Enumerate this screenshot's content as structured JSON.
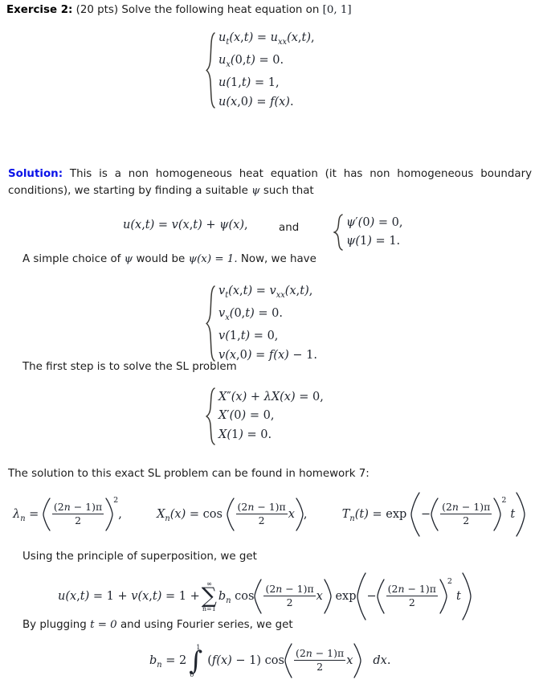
{
  "document": {
    "exercise_label": "Exercise 2:",
    "exercise_prompt": "(20 pts) Solve the following heat equation on",
    "interval": "[0, 1]",
    "solution_label": "Solution:",
    "solution_intro": "This is a non homogeneous heat equation (it has non homogeneous boundary conditions), we starting by finding a suitable",
    "solution_intro_symbol": "ψ",
    "solution_intro_tail": "such that",
    "psi_choice_pre": "A simple choice of",
    "psi_choice_sym": "ψ",
    "psi_choice_mid": "would be",
    "psi_choice_eq": "ψ(x) = 1.",
    "psi_choice_tail": "Now, we have",
    "sl_intro": "The first step is to solve the SL problem",
    "sl_solution_ref": "The solution to this exact SL problem can be found in homework 7:",
    "superposition_intro": "Using the principle of superposition, we get",
    "fourier_intro_pre": "By plugging",
    "fourier_intro_eq": "t = 0",
    "fourier_intro_tail": "and using Fourier series, we get",
    "and_word": "and"
  },
  "equations": {
    "heat_system": {
      "name": "original-heat-equation-system",
      "rows": [
        {
          "lhs_fn": "u",
          "lhs_sub": "t",
          "lhs_args": "(x, t)",
          "eq": "=",
          "rhs_fn": "u",
          "rhs_sub": "xx",
          "rhs_args": "(x, t),",
          "plain": "u_t(x,t) = u_xx(x,t),"
        },
        {
          "plain": "u_x(0,t) = 0."
        },
        {
          "plain": "u(1,t) = 1,"
        },
        {
          "plain": "u(x,0) = f(x)."
        }
      ]
    },
    "substitution": {
      "name": "substitution-equation",
      "text": "u(x,t) = v(x,t) + ψ(x),"
    },
    "psi_conditions": {
      "name": "psi-boundary-conditions",
      "rows": [
        "ψ'(0) = 0,",
        "ψ(1) = 1."
      ]
    },
    "v_system": {
      "name": "transformed-v-system",
      "rows": [
        "v_t(x,t) = v_xx(x,t),",
        "v_x(0,t) = 0.",
        "v(1,t) = 0,",
        "v(x,0) = f(x) − 1."
      ]
    },
    "sl_problem": {
      "name": "sturm-liouville-problem",
      "rows": [
        "X″(x) + λX(x) = 0,",
        "X′(0) = 0,",
        "X(1) = 0."
      ]
    },
    "eigen_line": {
      "name": "eigenvalue-eigenfunction-line",
      "lambda_lhs": "λ",
      "lambda_sub": "n",
      "numerator": "(2n − 1)π",
      "denominator": "2",
      "exponent": "2",
      "lambda_tail": ",",
      "X_lhs": "X",
      "X_sub": "n",
      "X_args": "(x)",
      "X_op": "cos",
      "X_var": "x",
      "T_lhs": "T",
      "T_sub": "n",
      "T_args": "(t)",
      "T_op": "exp",
      "T_minus": "−",
      "T_var": "t"
    },
    "superposition": {
      "name": "superposition-solution",
      "lhs": "u(x,t) = 1 + v(x,t) = 1 +",
      "sum_top": "∞",
      "sum_bottom": "n=1",
      "coefficient": "b",
      "coefficient_sub": "n",
      "cos_op": "cos",
      "numerator": "(2n − 1)π",
      "denominator": "2",
      "cos_var": "x",
      "exp_op": "exp",
      "minus": "−",
      "exponent": "2",
      "exp_var": "t"
    },
    "fourier_coefficient": {
      "name": "fourier-coefficient-formula",
      "lhs": "b",
      "lhs_sub": "n",
      "eq": "= 2",
      "int_top": "1",
      "int_bottom": "0",
      "integrand_pre": "(f(x) − 1)",
      "cos_op": "cos",
      "numerator": "(2n − 1)π",
      "denominator": "2",
      "cos_var": "x",
      "differential": "dx."
    }
  },
  "colors": {
    "body_text": "#1c1c1c",
    "solution_accent": "#0a12e8",
    "math_text": "#20252e",
    "brace": "#3b3a36",
    "background": "#ffffff"
  }
}
